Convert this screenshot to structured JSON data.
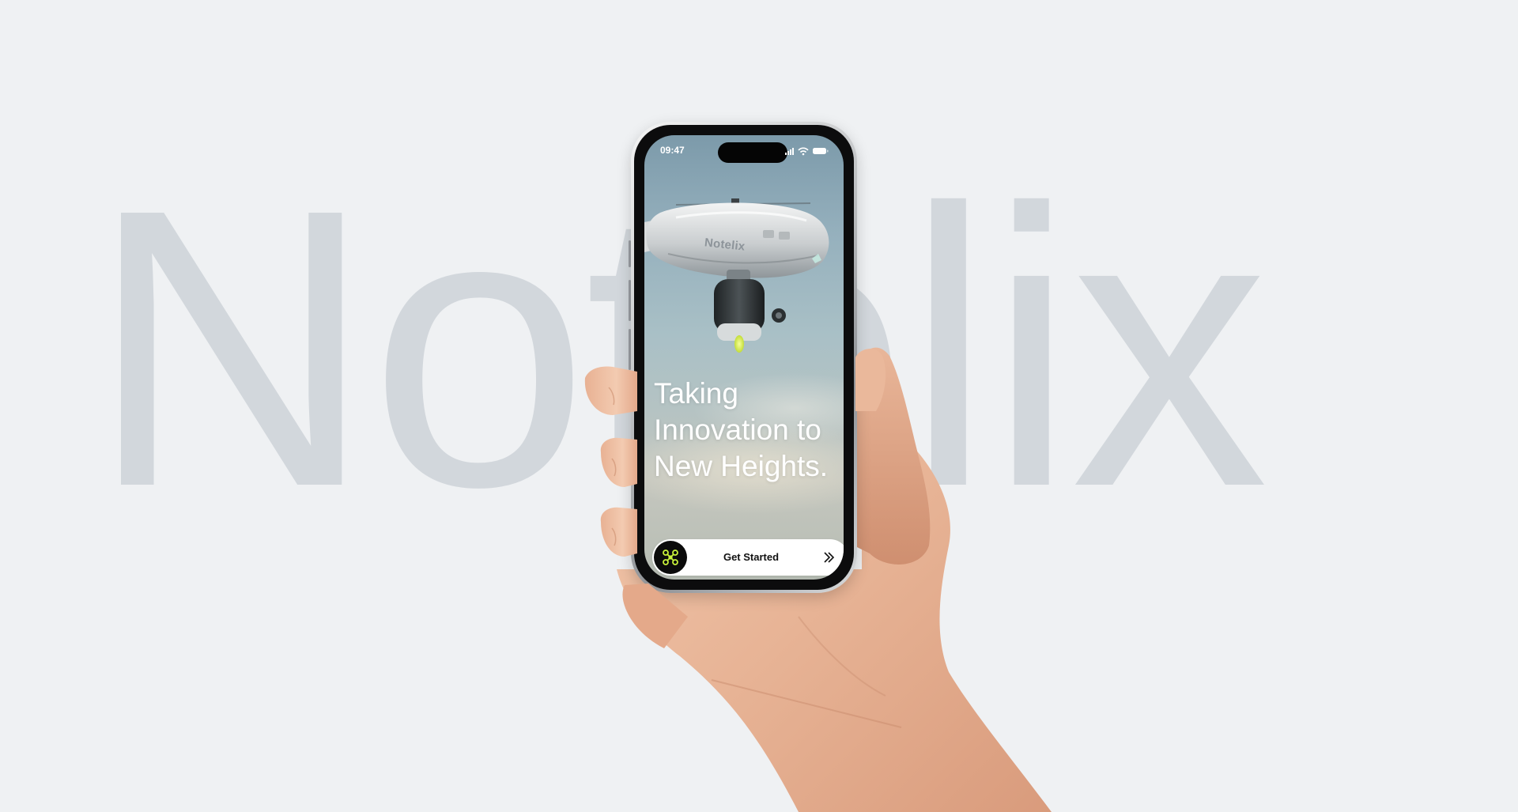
{
  "background": {
    "brand_word": "Notelix",
    "color": "#eff1f3",
    "word_color": "#d2d7dc"
  },
  "status_bar": {
    "time": "09:47",
    "icons": [
      "cellular-signal-icon",
      "wifi-icon",
      "battery-icon"
    ]
  },
  "drone": {
    "brand_label": "Notelix"
  },
  "hero": {
    "headline_line1": "Taking",
    "headline_line2": "Innovation to",
    "headline_line3": "New Heights."
  },
  "cta": {
    "label": "Get Started",
    "knob_icon": "drone-icon",
    "arrow_icon": "double-chevron-right-icon",
    "accent_color": "#c8f23a"
  }
}
